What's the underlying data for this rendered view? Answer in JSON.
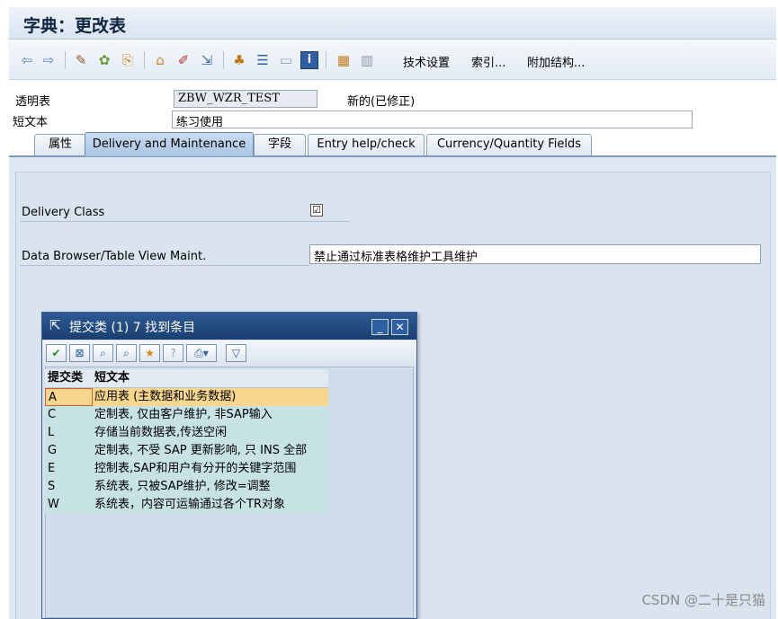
{
  "window": {
    "title": "字典：更改表"
  },
  "toolbar": {
    "tech_settings": "技术设置",
    "index": "索引...",
    "append_structure": "附加结构..."
  },
  "fields": {
    "transparent_table_label": "透明表",
    "table_name": "ZBW_WZR_TEST",
    "status": "新的(已修正)",
    "short_text_label": "短文本",
    "short_text": "练习使用"
  },
  "tabs": [
    {
      "label": "属性"
    },
    {
      "label": "Delivery and Maintenance"
    },
    {
      "label": "字段"
    },
    {
      "label": "Entry help/check"
    },
    {
      "label": "Currency/Quantity Fields"
    }
  ],
  "panel": {
    "delivery_class_label": "Delivery Class",
    "delivery_class_checkbox": "☑",
    "browser_label": "Data Browser/Table View Maint.",
    "browser_value": "禁止通过标准表格维护工具维护"
  },
  "popup": {
    "title": "提交类 (1)    7 找到条目",
    "col_key": "提交类",
    "col_text": "短文本",
    "rows": [
      {
        "key": "A",
        "text": "应用表 (主数据和业务数据)"
      },
      {
        "key": "C",
        "text": "定制表, 仅由客户维护, 非SAP输入"
      },
      {
        "key": "L",
        "text": "存储当前数据表,传送空闲"
      },
      {
        "key": "G",
        "text": "定制表, 不受 SAP 更新影响, 只 INS 全部"
      },
      {
        "key": "E",
        "text": "控制表,SAP和用户有分开的关键字范围"
      },
      {
        "key": "S",
        "text": "系统表, 只被SAP维护, 修改=调整"
      },
      {
        "key": "W",
        "text": "系统表，内容可运输通过各个TR对象"
      }
    ]
  },
  "watermark": "CSDN @二十是只猫",
  "colors": {
    "selected_row": "#f7d68d",
    "list_row": "#c6e2e4",
    "title_bar": "#1a3f70"
  }
}
